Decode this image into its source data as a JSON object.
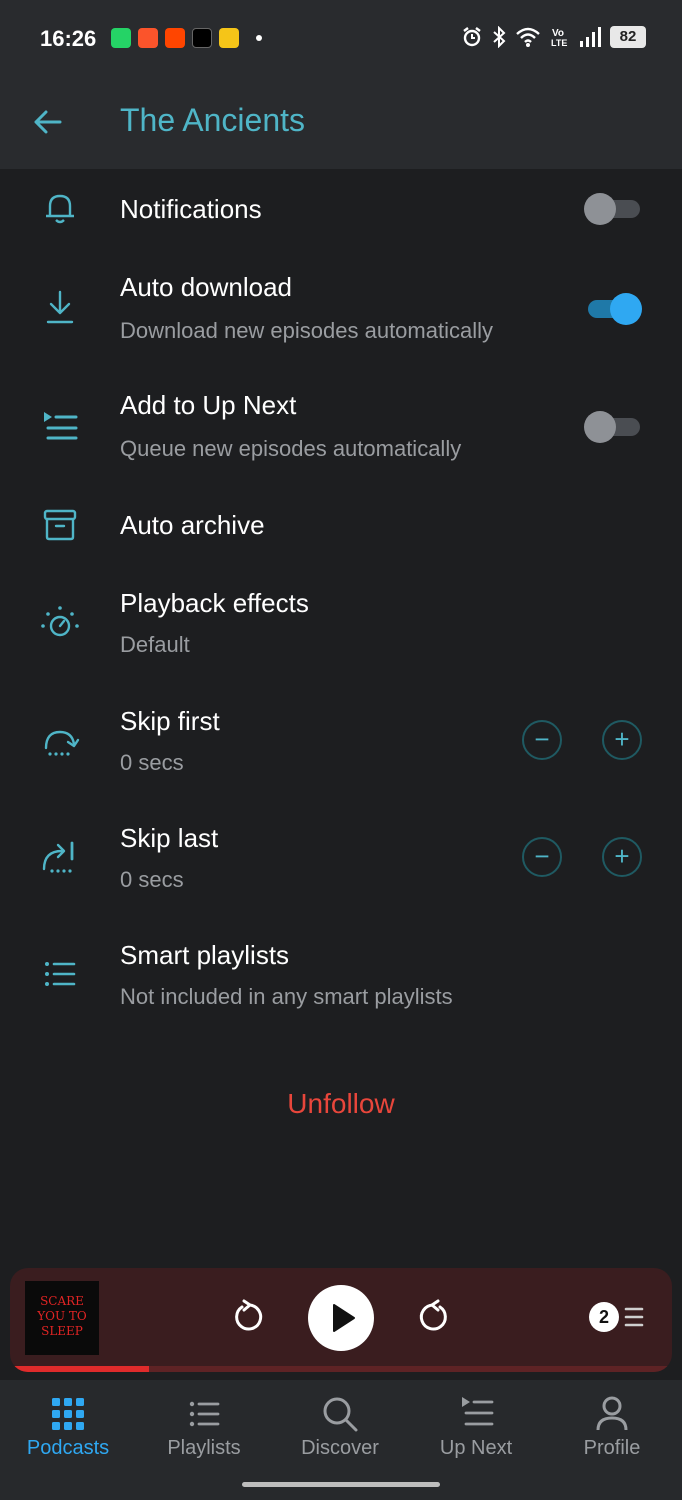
{
  "status_bar": {
    "time": "16:26",
    "notification_icons": [
      "whatsapp-icon",
      "brave-icon",
      "reddit-icon",
      "x-icon",
      "app-icon"
    ],
    "battery": "82"
  },
  "app_bar": {
    "title": "The Ancients"
  },
  "settings": {
    "notifications": {
      "label": "Notifications",
      "enabled": false
    },
    "auto_download": {
      "label": "Auto download",
      "sub": "Download new episodes automatically",
      "enabled": true
    },
    "add_to_up_next": {
      "label": "Add to Up Next",
      "sub": "Queue new episodes automatically",
      "enabled": false
    },
    "auto_archive": {
      "label": "Auto archive"
    },
    "playback_effects": {
      "label": "Playback effects",
      "sub": "Default"
    },
    "skip_first": {
      "label": "Skip first",
      "sub": "0 secs"
    },
    "skip_last": {
      "label": "Skip last",
      "sub": "0 secs"
    },
    "smart_playlists": {
      "label": "Smart playlists",
      "sub": "Not included in any smart playlists"
    }
  },
  "unfollow_label": "Unfollow",
  "mini_player": {
    "artwork_lines": [
      "SCARE",
      "YOU TO",
      "SLEEP"
    ],
    "up_next_count": "2",
    "progress": 0.21
  },
  "tabs": [
    {
      "label": "Podcasts",
      "icon": "grid-icon",
      "active": true
    },
    {
      "label": "Playlists",
      "icon": "list-icon",
      "active": false
    },
    {
      "label": "Discover",
      "icon": "search-icon",
      "active": false
    },
    {
      "label": "Up Next",
      "icon": "up-next-icon",
      "active": false
    },
    {
      "label": "Profile",
      "icon": "profile-icon",
      "active": false
    }
  ],
  "colors": {
    "accent": "#4fb5c7",
    "toggle_on": "#2fa8f2",
    "unfollow": "#e8463b",
    "background": "#1d1e20"
  }
}
